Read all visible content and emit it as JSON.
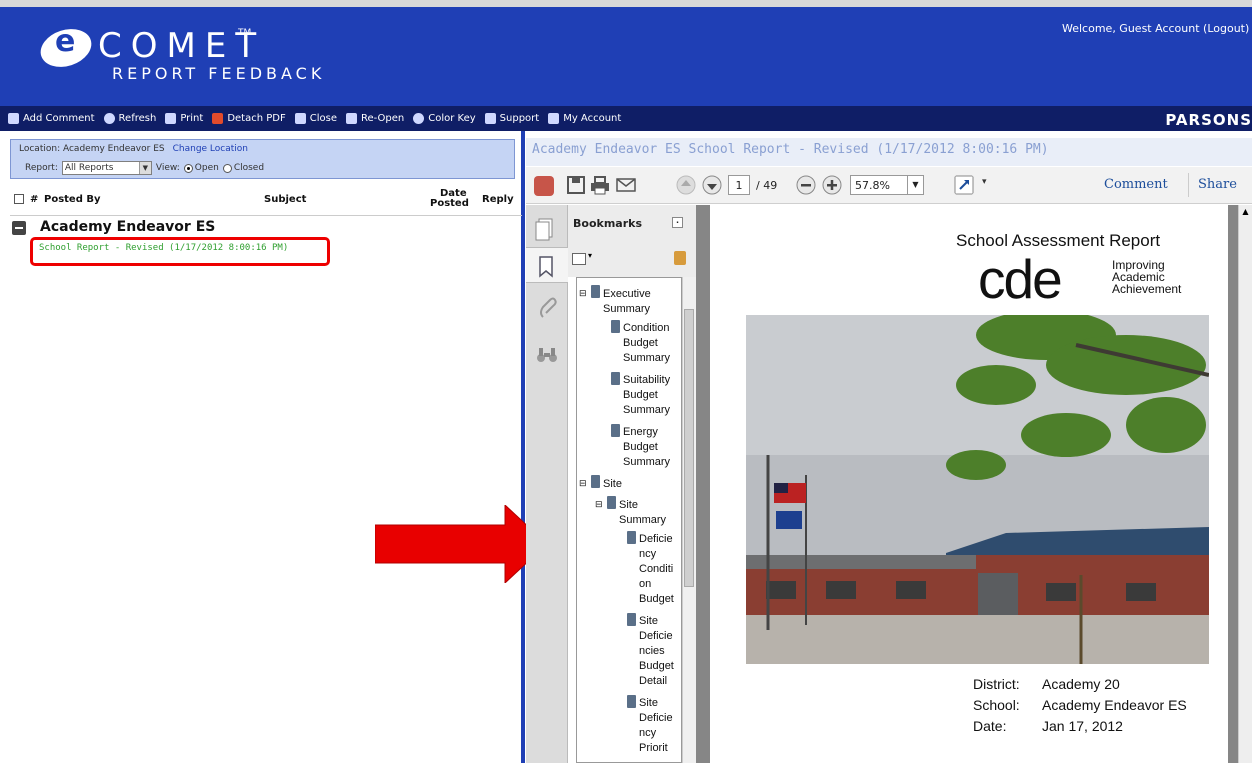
{
  "header": {
    "logo_letter": "e",
    "logo_name": "COMET",
    "logo_tm": "TM",
    "logo_sub": "REPORT FEEDBACK",
    "welcome": "Welcome, Guest Account (Logout)"
  },
  "toolbar": {
    "items": [
      "Add Comment",
      "Refresh",
      "Print",
      "Detach PDF",
      "Close",
      "Re-Open",
      "Color Key",
      "Support",
      "My Account"
    ],
    "brand": "PARSONS"
  },
  "filter": {
    "location_label": "Location:",
    "location_value": "Academy Endeavor ES",
    "change_location": "Change Location",
    "report_label": "Report:",
    "report_value": "All Reports",
    "view_label": "View:",
    "open_label": "Open",
    "closed_label": "Closed",
    "view_selected": "Open"
  },
  "comments_table": {
    "col_num": "#",
    "col_posted_by": "Posted By",
    "col_subject": "Subject",
    "col_date_1": "Date",
    "col_date_2": "Posted",
    "col_reply": "Reply",
    "group_title": "Academy Endeavor ES",
    "report_link": "School Report - Revised (1/17/2012 8:00:16 PM)"
  },
  "viewer": {
    "title": "Academy Endeavor ES School Report - Revised (1/17/2012 8:00:16 PM)",
    "page_current": "1",
    "page_total": "/ 49",
    "zoom": "57.8%",
    "comment": "Comment",
    "share": "Share",
    "bookmarks_label": "Bookmarks"
  },
  "bookmarks": [
    "Executive",
    "Summary",
    "Condition",
    "Budget",
    "Summary",
    "Suitability",
    "Budget",
    "Summary",
    "Energy",
    "Budget",
    "Summary",
    "Site",
    "Site",
    "Summary",
    "Deficie",
    "ncy",
    "Conditi",
    "on",
    "Budget",
    "Site",
    "Deficie",
    "ncies",
    "Budget",
    "Detail",
    "Site",
    "Deficie",
    "ncy",
    "Priorit"
  ],
  "document": {
    "title": "School Assessment Report",
    "logo": "cde",
    "tagline_1": "Improving",
    "tagline_2": "Academic",
    "tagline_3": "Achievement",
    "district_label": "District:",
    "district_value": "Academy 20",
    "school_label": "School:",
    "school_value": "Academy Endeavor ES",
    "date_label": "Date:",
    "date_value": "Jan 17, 2012"
  },
  "colors": {
    "header_blue": "#1f3fb5",
    "toolbar_navy": "#0f1e66",
    "link_green": "#2f9f2f",
    "highlight_red": "#e00000"
  }
}
